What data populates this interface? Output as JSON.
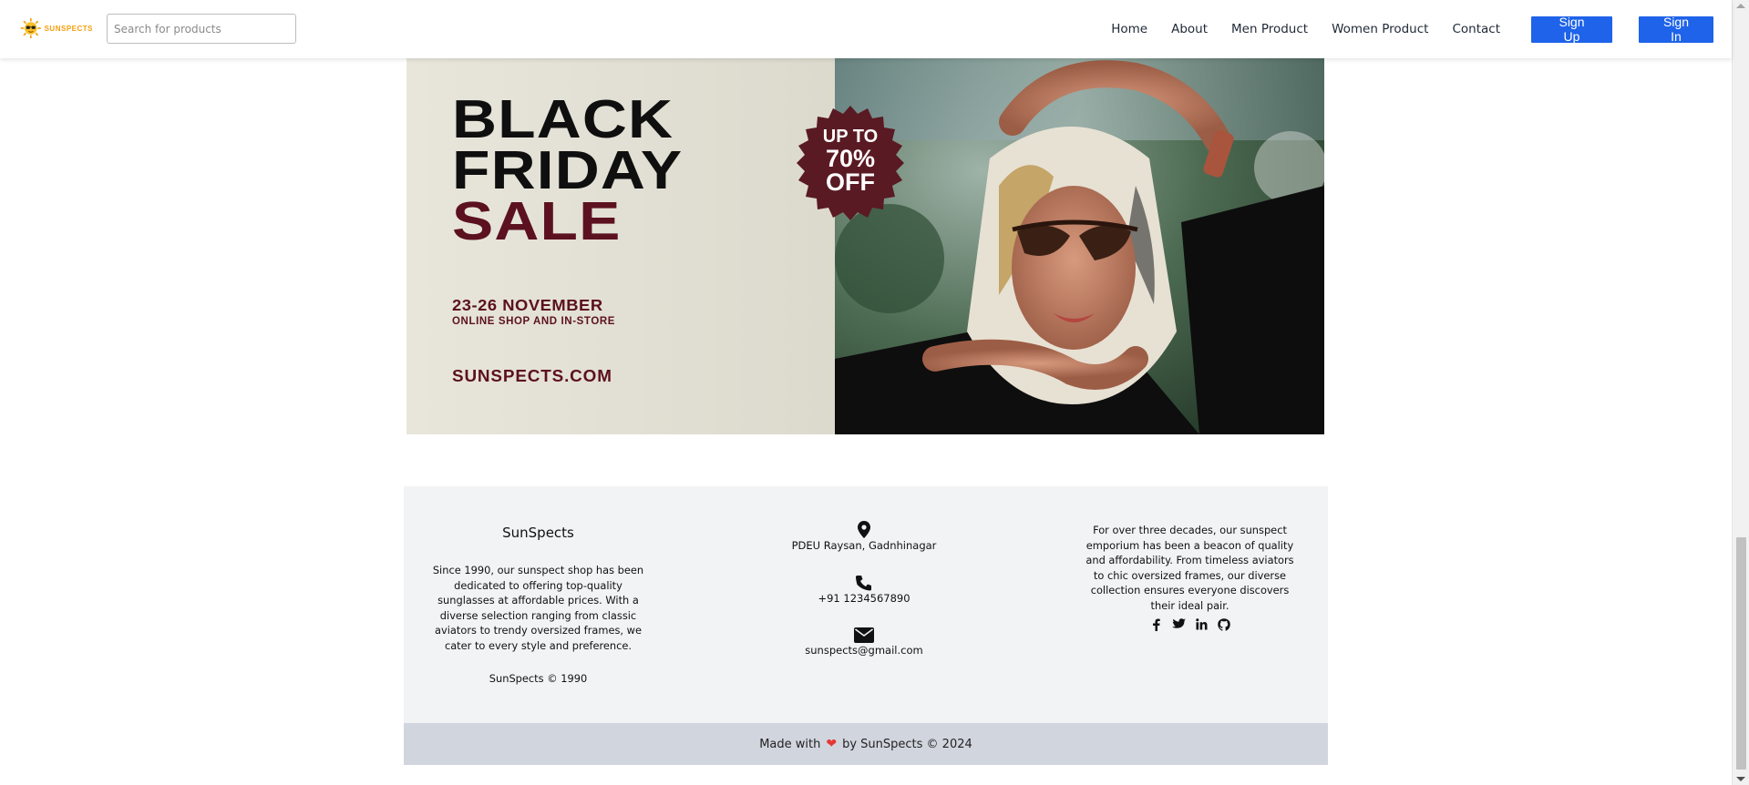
{
  "brand": {
    "name": "SUNSPECTS"
  },
  "search": {
    "placeholder": "Search for products",
    "value": ""
  },
  "nav": {
    "links": [
      "Home",
      "About",
      "Men Product",
      "Women Product",
      "Contact"
    ],
    "signup_label": "Sign Up",
    "signin_label": "Sign In",
    "button_color": "#1e63e9"
  },
  "banner": {
    "line1": "BLACK",
    "line2": "FRIDAY",
    "line3": "SALE",
    "badge_line1": "UP TO",
    "badge_line2": "70%",
    "badge_line3": "OFF",
    "dates": "23-26 NOVEMBER",
    "subtitle": "ONLINE SHOP AND IN-STORE",
    "website": "SUNSPECTS.COM",
    "accent_color": "#5c1120"
  },
  "footer": {
    "col1": {
      "title": "SunSpects",
      "text": "Since 1990, our sunspect shop has been dedicated to offering top-quality sunglasses at affordable prices. With a diverse selection ranging from classic aviators to trendy oversized frames, we cater to every style and preference.",
      "copyright": "SunSpects © 1990"
    },
    "contact": {
      "address_icon": "map-pin-icon",
      "address": "PDEU Raysan, Gadnhinagar",
      "phone_icon": "phone-icon",
      "phone": "+91 1234567890",
      "email_icon": "envelope-icon",
      "email": "sunspects@gmail.com"
    },
    "col3": {
      "text": "For over three decades, our sunspect emporium has been a beacon of quality and affordability. From timeless aviators to chic oversized frames, our diverse collection ensures everyone discovers their ideal pair."
    },
    "socials": [
      "facebook-icon",
      "twitter-icon",
      "linkedin-icon",
      "github-icon"
    ],
    "bottom": {
      "prefix": "Made with",
      "suffix": "by SunSpects © 2024"
    }
  }
}
